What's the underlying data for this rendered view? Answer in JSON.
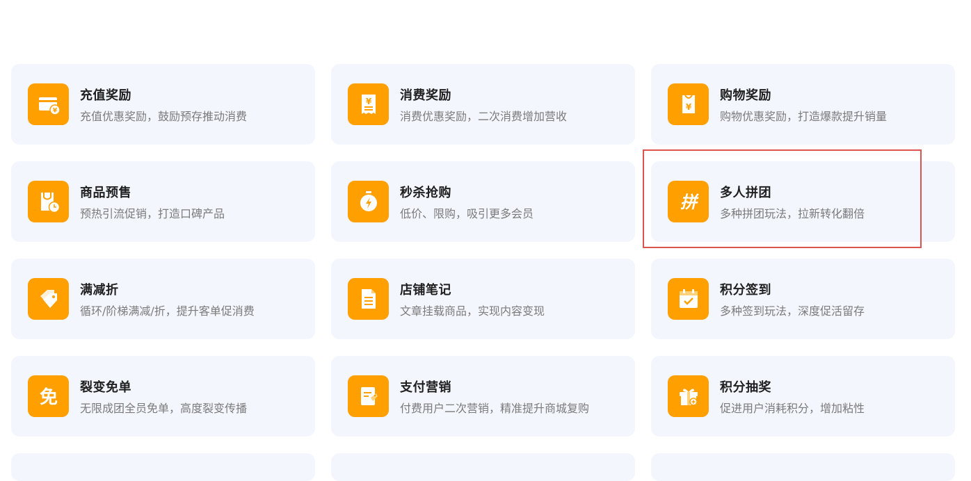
{
  "colors": {
    "card_bg": "#f3f6fd",
    "icon_bg": "#ff9f00",
    "title": "#1f1f1f",
    "desc": "#7a7a7a",
    "highlight": "#d9534f"
  },
  "cards": [
    {
      "title": "充值奖励",
      "desc": "充值优惠奖励，鼓励预存推动消费",
      "icon": "wallet-yen-icon"
    },
    {
      "title": "消费奖励",
      "desc": "消费优惠奖励，二次消费增加营收",
      "icon": "receipt-yen-icon"
    },
    {
      "title": "购物奖励",
      "desc": "购物优惠奖励，打造爆款提升销量",
      "icon": "bag-yen-icon"
    },
    {
      "title": "商品预售",
      "desc": "预热引流促销，打造口碑产品",
      "icon": "bag-clock-icon"
    },
    {
      "title": "秒杀抢购",
      "desc": "低价、限购，吸引更多会员",
      "icon": "stopwatch-icon"
    },
    {
      "title": "多人拼团",
      "desc": "多种拼团玩法，拉新转化翻倍",
      "icon": "pin-glyph-icon",
      "icon_glyph": "拼"
    },
    {
      "title": "满减折",
      "desc": "循环/阶梯满减/折，提升客单促消费",
      "icon": "tags-icon"
    },
    {
      "title": "店铺笔记",
      "desc": "文章挂载商品，实现内容变现",
      "icon": "document-icon"
    },
    {
      "title": "积分签到",
      "desc": "多种签到玩法，深度促活留存",
      "icon": "calendar-check-icon"
    },
    {
      "title": "裂变免单",
      "desc": "无限成团全员免单，高度裂变传播",
      "icon": "mian-glyph-icon",
      "icon_glyph": "免"
    },
    {
      "title": "支付营销",
      "desc": "付费用户二次营销，精准提升商城复购",
      "icon": "pay-document-icon"
    },
    {
      "title": "积分抽奖",
      "desc": "促进用户消耗积分，增加粘性",
      "icon": "gift-icon"
    }
  ]
}
